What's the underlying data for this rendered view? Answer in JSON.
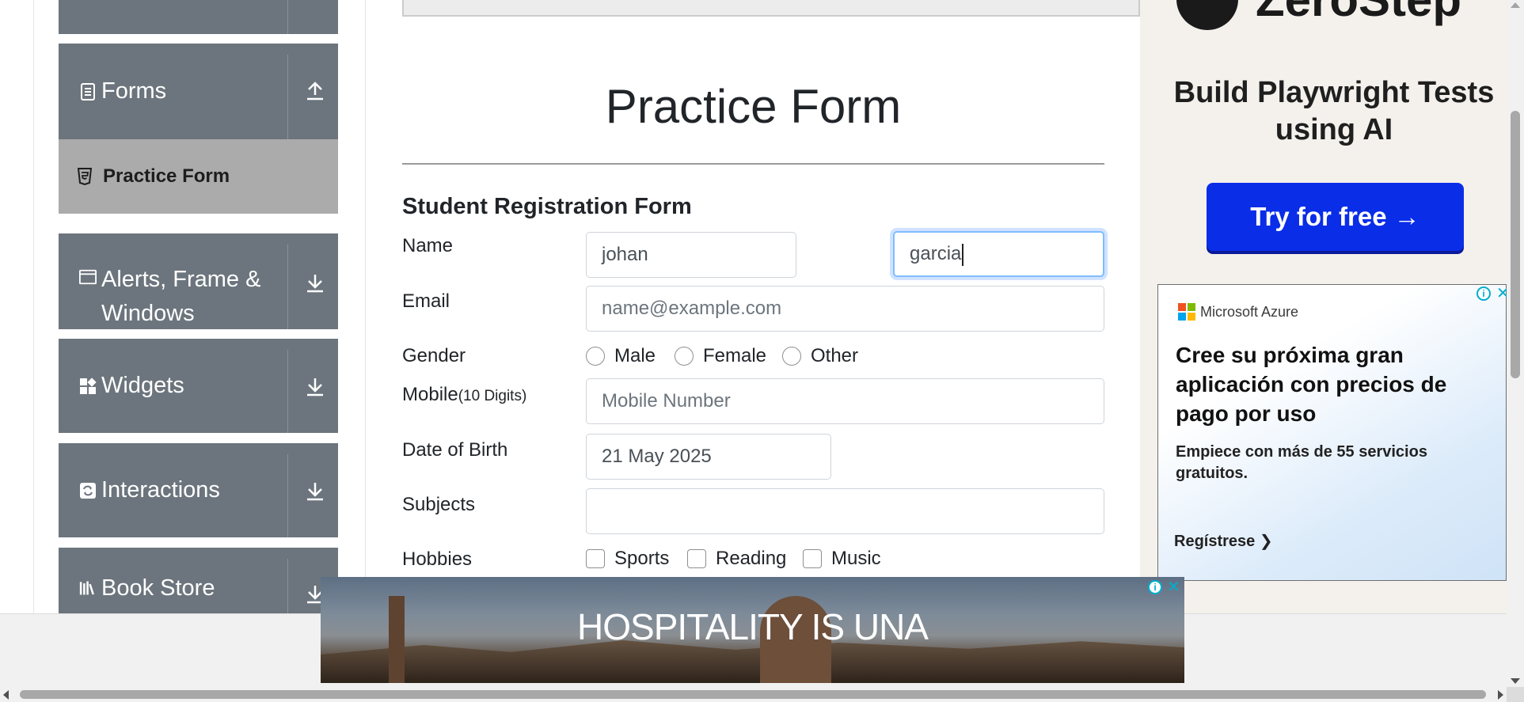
{
  "sidebar": {
    "groups": [
      {
        "label": "",
        "icon": "group-icon",
        "arrow": "chevron-down-icon"
      },
      {
        "label": "Forms",
        "icon": "form-icon",
        "arrow": "arrow-up-icon"
      },
      {
        "label": "Alerts, Frame & Windows",
        "icon": "window-icon",
        "arrow": "arrow-down-icon"
      },
      {
        "label": "Widgets",
        "icon": "widgets-icon",
        "arrow": "arrow-down-icon"
      },
      {
        "label": "Interactions",
        "icon": "interactions-icon",
        "arrow": "arrow-down-icon"
      },
      {
        "label": "Book Store",
        "icon": "books-icon",
        "arrow": "arrow-down-icon"
      }
    ],
    "active_item": {
      "label": "Practice Form",
      "icon": "html5-icon"
    }
  },
  "main": {
    "title": "Practice Form",
    "form_title": "Student Registration Form",
    "name": {
      "label": "Name",
      "first_name": "johan",
      "last_name": "garcia"
    },
    "email": {
      "label": "Email",
      "placeholder": "name@example.com"
    },
    "gender": {
      "label": "Gender",
      "options": [
        "Male",
        "Female",
        "Other"
      ]
    },
    "mobile": {
      "label": "Mobile",
      "hint": "(10 Digits)",
      "placeholder": "Mobile Number"
    },
    "dob": {
      "label": "Date of Birth",
      "value": "21 May 2025"
    },
    "subjects": {
      "label": "Subjects",
      "value": ""
    },
    "hobbies": {
      "label": "Hobbies",
      "options": [
        "Sports",
        "Reading",
        "Music"
      ]
    }
  },
  "ads": {
    "zerostep": {
      "brand": "ZeroStep",
      "headline": "Build Playwright Tests using AI",
      "button": "Try for free →",
      "button_color": "#0a2de8"
    },
    "azure": {
      "brand": "Microsoft Azure",
      "headline": "Cree su próxima gran aplicación con precios de pago por uso",
      "body": "Empiece con más de 55 servicios gratuitos.",
      "cta": "Regístrese ❯"
    },
    "banner": {
      "text": "HOSPITALITY IS UNA"
    }
  },
  "colors": {
    "sidebar_group": "#6c757d",
    "sidebar_active": "#ababab",
    "focus_border": "#80bdff"
  }
}
